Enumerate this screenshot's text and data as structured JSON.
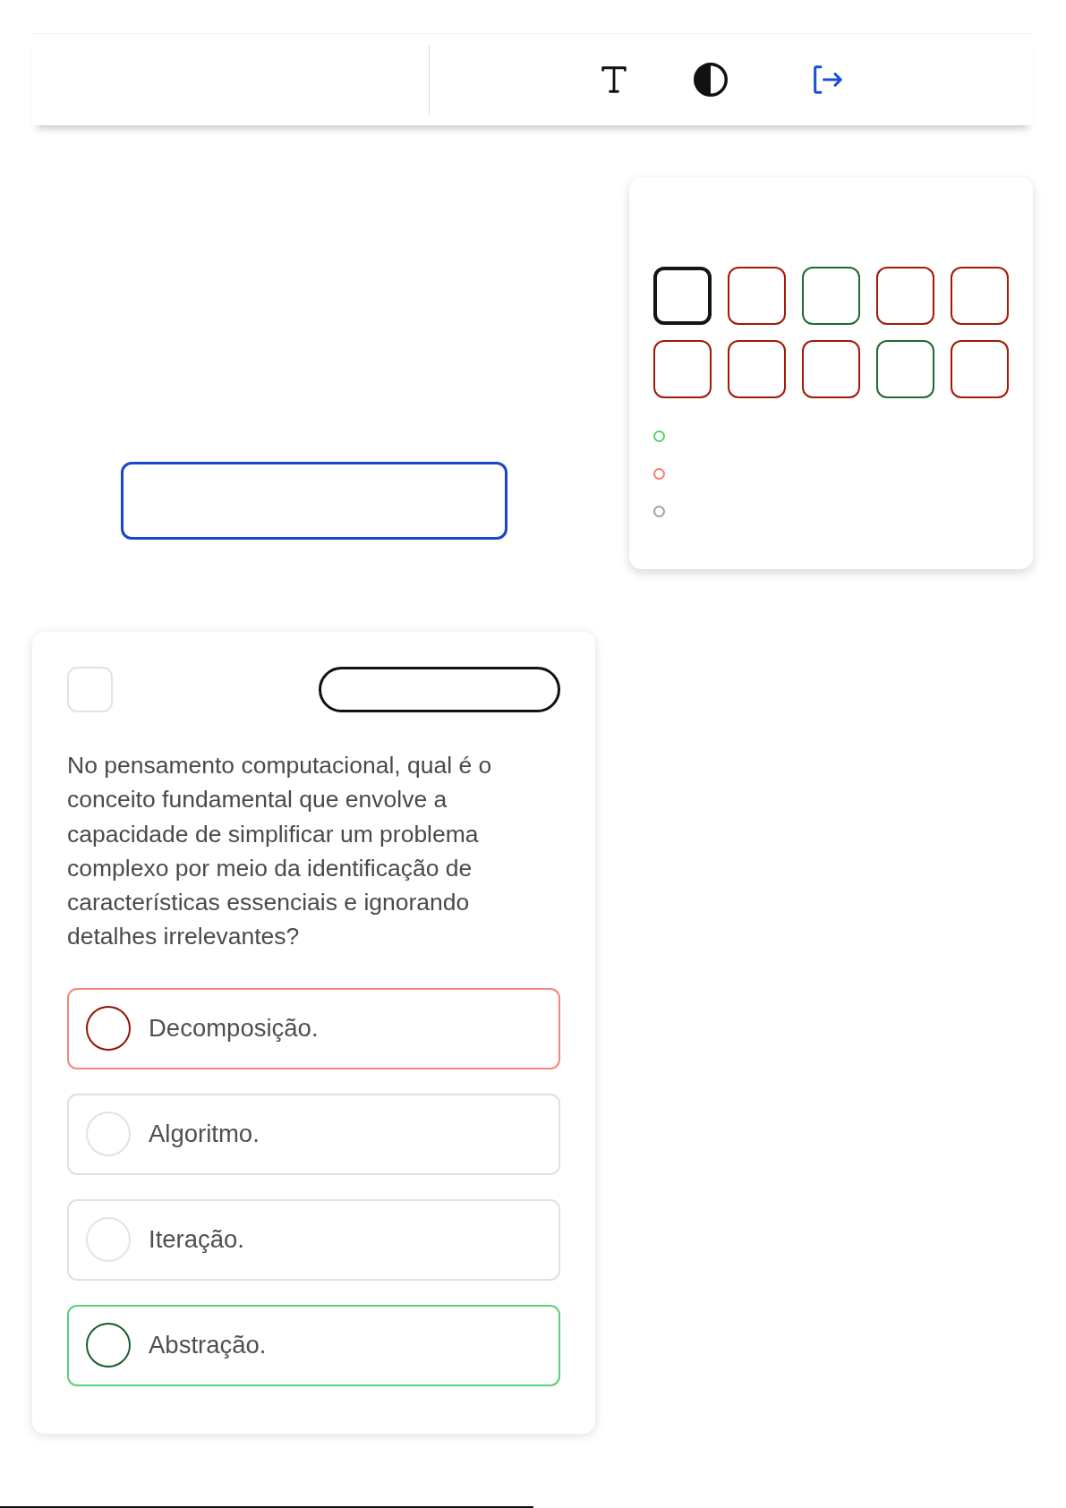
{
  "navigator": {
    "tiles": [
      {
        "selected": true,
        "color": "#141414"
      },
      {
        "selected": false,
        "color": "#a31b07"
      },
      {
        "selected": false,
        "color": "#1e6b32"
      },
      {
        "selected": false,
        "color": "#a31b07"
      },
      {
        "selected": false,
        "color": "#a31b07"
      },
      {
        "selected": false,
        "color": "#a31b07"
      },
      {
        "selected": false,
        "color": "#a31b07"
      },
      {
        "selected": false,
        "color": "#a31b07"
      },
      {
        "selected": false,
        "color": "#1e6b32"
      },
      {
        "selected": false,
        "color": "#a31b07"
      }
    ],
    "legend": [
      {
        "color": "#4fd36b"
      },
      {
        "color": "#f47c68"
      },
      {
        "color": "#9e9e9e"
      }
    ]
  },
  "question": {
    "checked": false,
    "text": "No pensamento computacional, qual é o conceito fundamental que envolve a capacidade de simplificar um problema complexo por meio da identificação de características essenciais e ignorando detalhes irrelevantes?",
    "options": [
      {
        "label": "Decomposição.",
        "selected": true,
        "correct": false
      },
      {
        "label": "Algoritmo.",
        "selected": false,
        "correct": false
      },
      {
        "label": "Iteração.",
        "selected": false,
        "correct": false
      },
      {
        "label": "Abstração.",
        "selected": false,
        "correct": true
      }
    ]
  }
}
